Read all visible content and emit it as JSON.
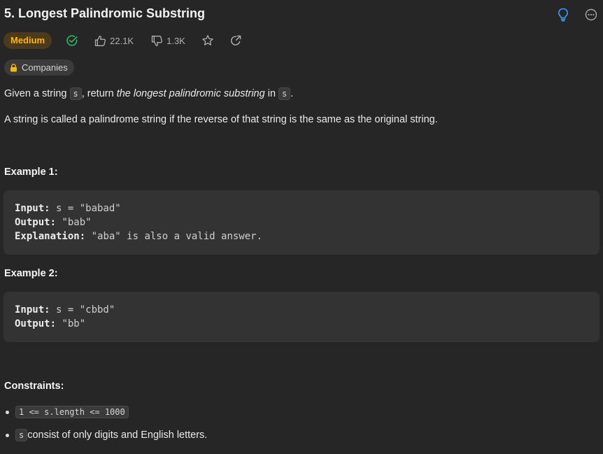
{
  "problem": {
    "title": "5. Longest Palindromic Substring",
    "difficulty": "Medium",
    "likes": "22.1K",
    "dislikes": "1.3K",
    "companies_label": "Companies"
  },
  "description": {
    "p1_a": "Given a string ",
    "p1_code1": "s",
    "p1_b": ", return ",
    "p1_em": "the longest palindromic substring",
    "p1_c": " in ",
    "p1_code2": "s",
    "p1_d": ".",
    "p2": "A string is called a palindrome string if the reverse of that string is the same as the original string."
  },
  "examples": [
    {
      "heading": "Example 1:",
      "input_label": "Input:",
      "input_value": " s = \"babad\"",
      "output_label": "Output:",
      "output_value": " \"bab\"",
      "explanation_label": "Explanation:",
      "explanation_value": " \"aba\" is also a valid answer."
    },
    {
      "heading": "Example 2:",
      "input_label": "Input:",
      "input_value": " s = \"cbbd\"",
      "output_label": "Output:",
      "output_value": " \"bb\""
    }
  ],
  "constraints": {
    "heading": "Constraints:",
    "c1_code": "1 <= s.length <= 1000",
    "c2_code": "s",
    "c2_text": " consist of only digits and English letters."
  },
  "colors": {
    "background": "#262626",
    "medium": "#ffb800",
    "solved": "#2cbb5d",
    "hint": "#3b9cff"
  },
  "icons": [
    "hint-lightbulb-icon",
    "more-options-icon",
    "solved-check-icon",
    "thumbs-up-icon",
    "thumbs-down-icon",
    "star-icon",
    "share-icon",
    "lock-icon"
  ]
}
